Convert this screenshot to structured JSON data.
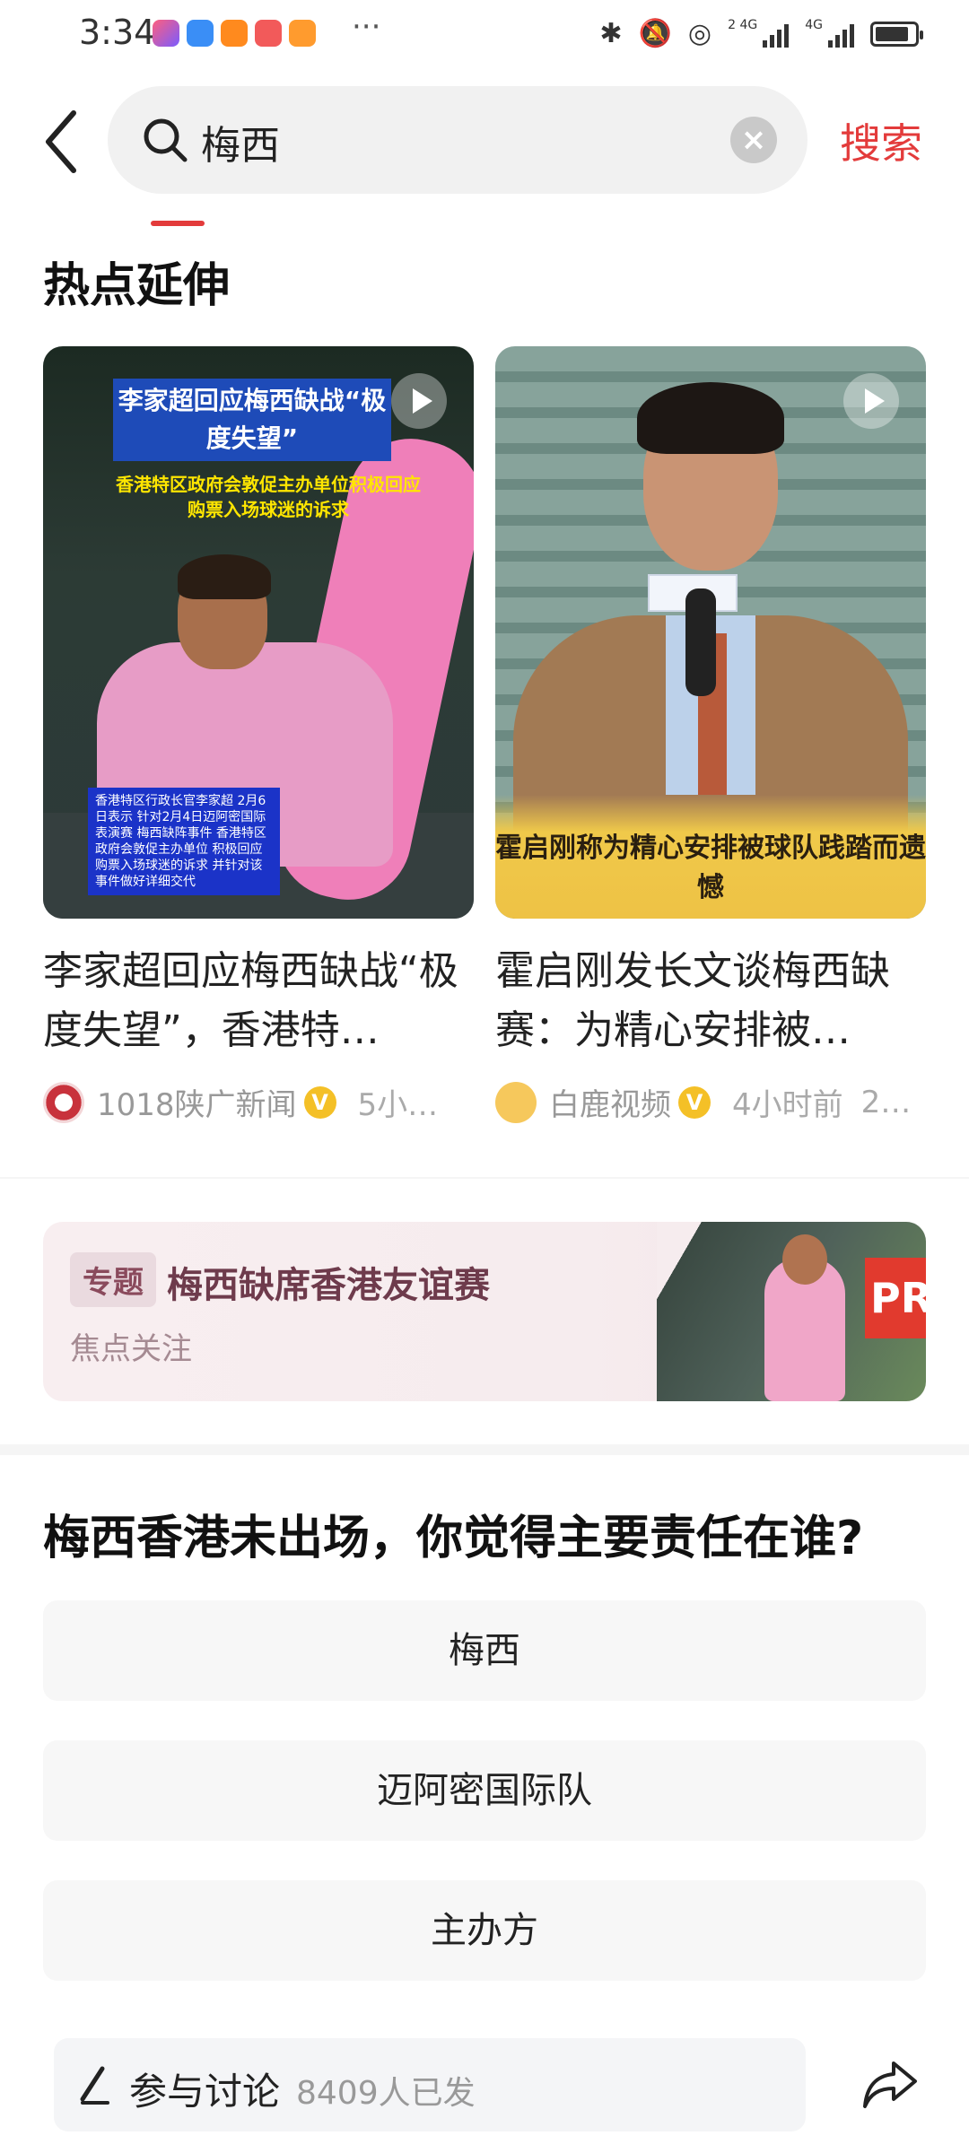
{
  "status_bar": {
    "time": "3:34",
    "dots": "···",
    "net1": "2 4G",
    "net2": "4G",
    "battery_level": 0.85
  },
  "search": {
    "query": "梅西",
    "submit_label": "搜索"
  },
  "section": {
    "title": "热点延伸"
  },
  "cards": [
    {
      "title": "李家超回应梅西缺战“极度失望”，香港特…",
      "source": "1018陕广新闻",
      "time": "5小…",
      "thumb_headline": "李家超回应梅西缺战“极度失望”",
      "thumb_subtitle": "香港特区政府会敦促主办单位积极回应购票入场球迷的诉求",
      "thumb_caption": "香港特区行政长官李家超 2月6日表示 针对2月4日迈阿密国际表演赛 梅西缺阵事件 香港特区政府会敦促主办单位 积极回应购票入场球迷的诉求 并针对该事件做好详细交代"
    },
    {
      "title": "霍启刚发长文谈梅西缺赛：为精心安排被…",
      "source": "白鹿视频",
      "time": "4小时前",
      "extra": "2…",
      "thumb_caption": "霍启刚称为精心安排被球队践踏而遗憾"
    }
  ],
  "topic": {
    "tag": "专题",
    "title": "梅西缺席香港友谊赛",
    "subtitle": "焦点关注",
    "board_text": "PR"
  },
  "poll": {
    "question": "梅西香港未出场，你觉得主要责任在谁?",
    "options": [
      "梅西",
      "迈阿密国际队",
      "主办方"
    ]
  },
  "bottom": {
    "discuss_label": "参与讨论",
    "discuss_count": "8409人已发"
  },
  "colors": {
    "accent": "#e33b3b",
    "verified_badge": "#f4c027"
  },
  "icons": [
    "back-icon",
    "search-icon",
    "clear-icon",
    "play-icon",
    "verified-icon",
    "pen-icon",
    "share-icon"
  ]
}
